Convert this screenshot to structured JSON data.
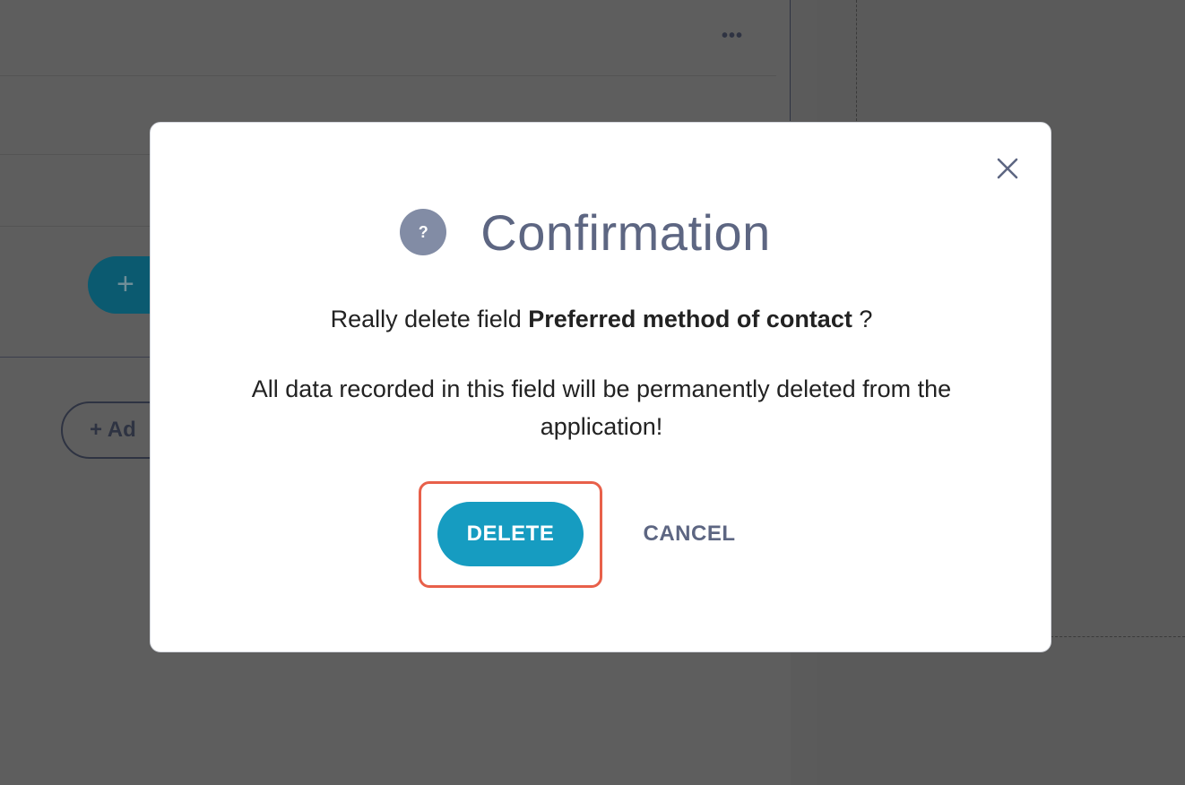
{
  "background": {
    "more_label": "•••",
    "add_button_plus": "+",
    "add_outline_label": "+ Ad"
  },
  "dialog": {
    "title": "Confirmation",
    "question_icon": "?",
    "message_prefix": "Really delete field ",
    "field_name": "Preferred method of contact",
    "message_suffix": " ?",
    "warning": "All data recorded in this field will be permanently deleted from the application!",
    "delete_label": "DELETE",
    "cancel_label": "CANCEL"
  },
  "colors": {
    "primary": "#169cc1",
    "highlight": "#e8604a",
    "title": "#5d6682",
    "icon_bg": "#828ca5"
  }
}
